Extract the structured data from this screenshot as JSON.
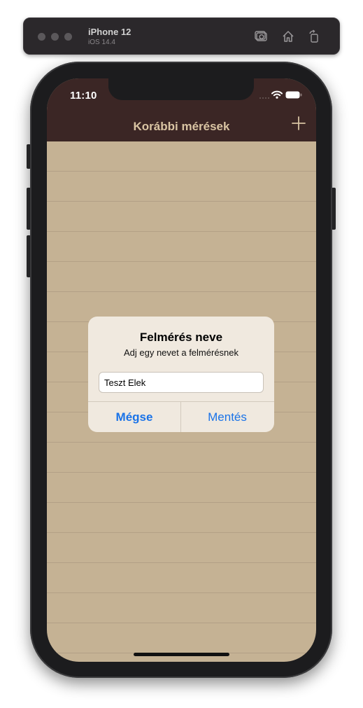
{
  "simulator": {
    "device_name": "iPhone 12",
    "os_version": "iOS 14.4",
    "toolbar_icons": [
      "screenshot-icon",
      "home-icon",
      "rotate-icon"
    ]
  },
  "status_bar": {
    "time": "11:10",
    "icons": [
      "wifi-icon",
      "battery-icon"
    ]
  },
  "nav": {
    "title": "Korábbi mérések",
    "add_icon": "plus-icon"
  },
  "alert": {
    "title": "Felmérés neve",
    "message": "Adj egy nevet a felmérésnek",
    "input_value": "Teszt Elek",
    "cancel_label": "Mégse",
    "save_label": "Mentés"
  },
  "colors": {
    "nav_background": "#3b2625",
    "nav_title": "#d9c4a3",
    "list_background": "#c5b294",
    "alert_background": "#f0e9df",
    "accent": "#1a73e8"
  }
}
